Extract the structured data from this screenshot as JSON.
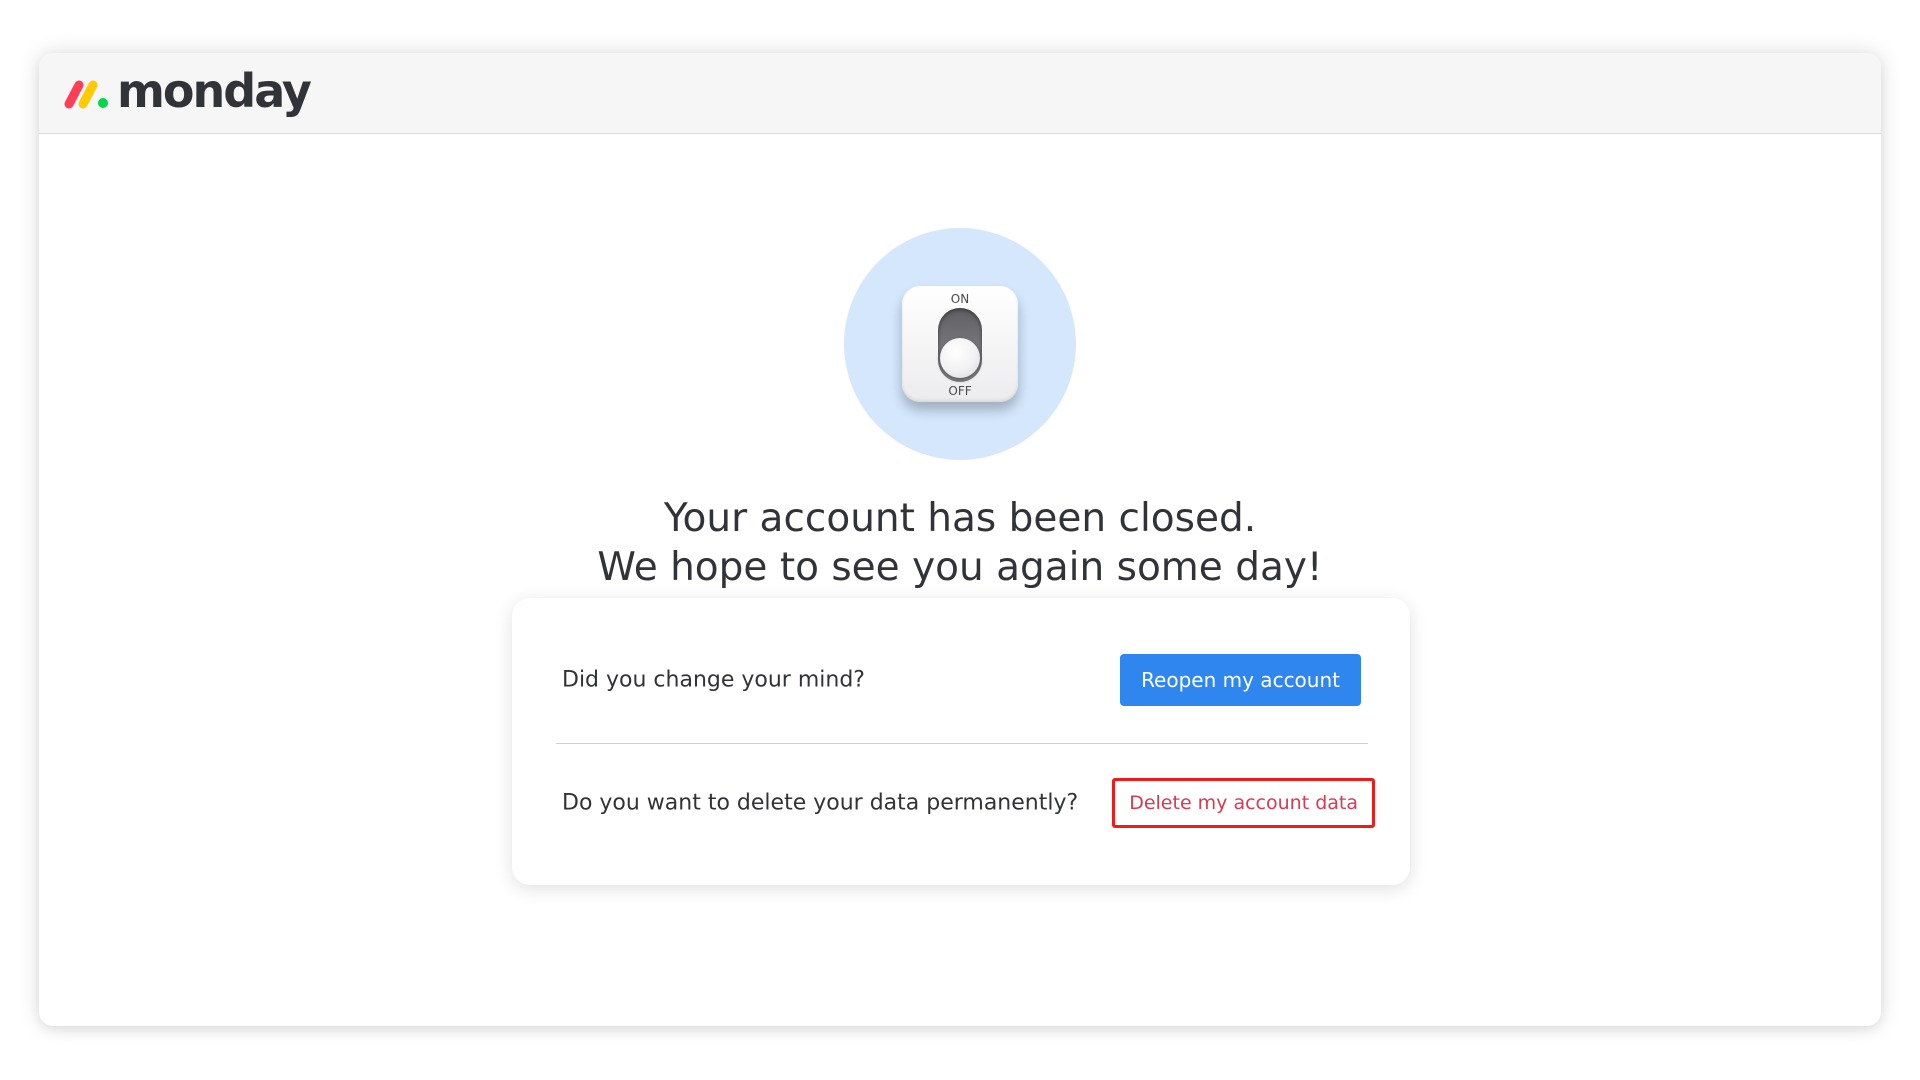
{
  "header": {
    "brand": "monday",
    "logo_colors": [
      "#ff3d57",
      "#ffcb00",
      "#00d647"
    ]
  },
  "illustration": {
    "icon": "on-off-switch-icon",
    "on_label": "ON",
    "off_label": "OFF",
    "state": "off"
  },
  "message": {
    "line1": "Your account has been closed.",
    "line2": "We hope to see you again some day!"
  },
  "options": {
    "reopen_prompt": "Did you change your mind?",
    "reopen_label": "Reopen my account",
    "delete_prompt": "Do you want to delete your data permanently?",
    "delete_label": "Delete my account data"
  },
  "colors": {
    "primary": "#2f86ef",
    "danger_text": "#d83a52",
    "highlight_border": "#ee1b1b",
    "illustration_bg": "#d4e7fd"
  }
}
